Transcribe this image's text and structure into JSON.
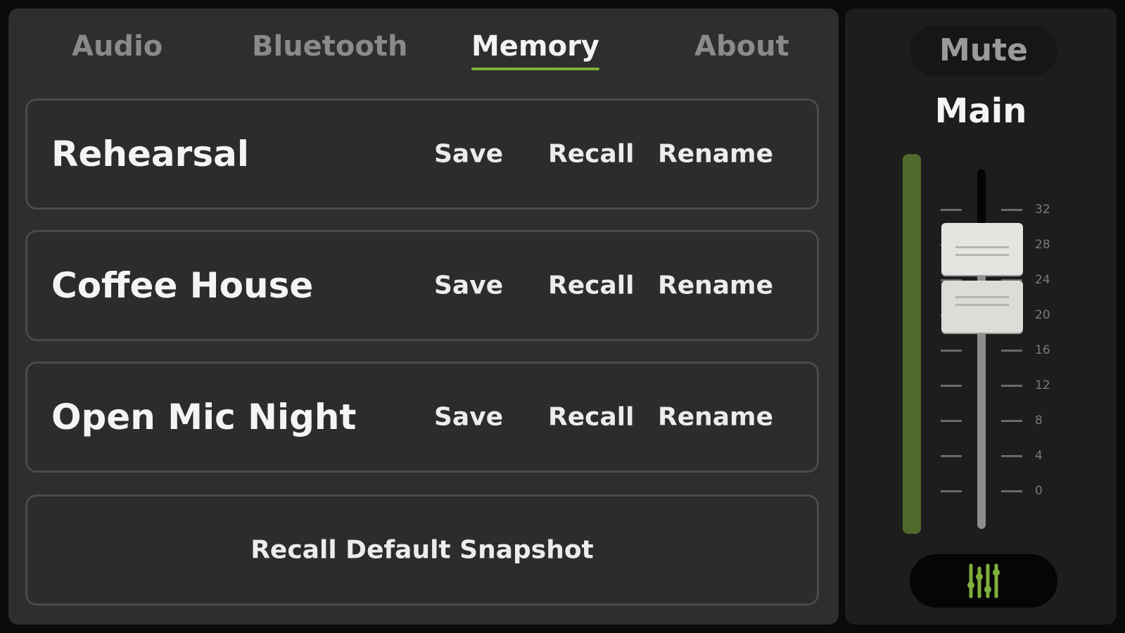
{
  "tabs": [
    {
      "label": "Audio",
      "active": false
    },
    {
      "label": "Bluetooth",
      "active": false
    },
    {
      "label": "Memory",
      "active": true
    },
    {
      "label": "About",
      "active": false
    }
  ],
  "snapshots": [
    {
      "name": "Rehearsal"
    },
    {
      "name": "Coffee House"
    },
    {
      "name": "Open Mic Night"
    }
  ],
  "actions": {
    "save": "Save",
    "recall": "Recall",
    "rename": "Rename"
  },
  "default_snapshot_label": "Recall Default Snapshot",
  "side_panel": {
    "mute_label": "Mute",
    "channel_label": "Main",
    "fader_scale": [
      "32",
      "28",
      "24",
      "20",
      "16",
      "12",
      "8",
      "4",
      "0"
    ],
    "mixer_icon": "mixer-sliders-icon"
  },
  "colors": {
    "accent": "#7fae3c",
    "meter": "#4f6a2a",
    "panel_bg": "#2e2e2e",
    "side_bg": "#1d1d1d"
  }
}
